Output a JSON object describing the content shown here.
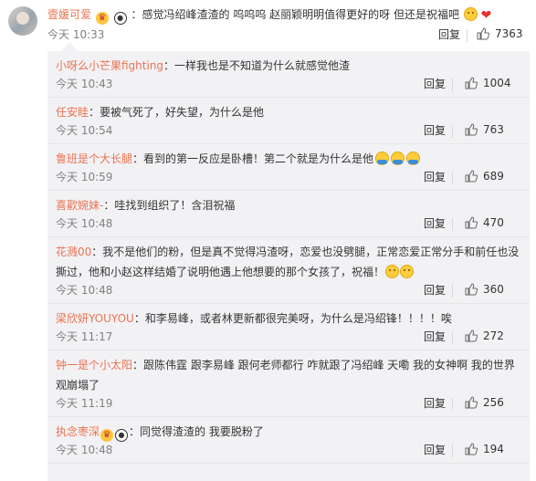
{
  "top_comment": {
    "username": "壹媛可爱",
    "badges": [
      "gold-badge",
      "panda-badge"
    ],
    "text": "：感觉冯绍峰渣渣的 呜呜呜 赵丽颖明明值得更好的呀 但还是祝福吧",
    "emojis": [
      "sad-face-emoji",
      "heart-icon"
    ],
    "time": "今天 10:33",
    "reply_label": "回复",
    "likes": "7363"
  },
  "sub_comments": [
    {
      "username": "小呀么小芒果fighting",
      "badges": [],
      "text": "：一样我也是不知道为什么就感觉他渣",
      "time": "今天 10:43",
      "reply_label": "回复",
      "likes": "1004"
    },
    {
      "username": "任安眭",
      "badges": [],
      "text": "：要被气死了，好失望，为什么是他",
      "time": "今天 10:54",
      "reply_label": "回复",
      "likes": "763"
    },
    {
      "username": "鲁班是个大长腿",
      "badges": [],
      "text": "：看到的第一反应是卧槽！第二个就是为什么是他",
      "emojis": [
        "hug-emoji",
        "hug-emoji",
        "hug-emoji"
      ],
      "time": "今天 10:59",
      "reply_label": "回复",
      "likes": "689"
    },
    {
      "username": "喜歡婉妹-",
      "badges": [],
      "text": "：哇找到组织了！含泪祝福",
      "time": "今天 10:48",
      "reply_label": "回复",
      "likes": "470"
    },
    {
      "username": "花溅00",
      "badges": [],
      "text": "：我不是他们的粉，但是真不觉得冯渣呀，恋爱也没劈腿，正常恋爱正常分手和前任也没撕过，他和小赵这样结婚了说明他遇上他想要的那个女孩了，祝福！",
      "emojis": [
        "smile-emoji",
        "smile-emoji"
      ],
      "time": "今天 10:48",
      "reply_label": "回复",
      "likes": "360"
    },
    {
      "username": "梁欣妍YOUYOU",
      "badges": [],
      "text": "：和李易峰，或者林更新都很完美呀，为什么是冯绍锋！！！！唉",
      "time": "今天 11:17",
      "reply_label": "回复",
      "likes": "272"
    },
    {
      "username": "钟一是个小太阳",
      "badges": [],
      "text": "：跟陈伟霆 跟李易峰 跟何老师都行 咋就跟了冯绍峰 天嘞 我的女神啊 我的世界观崩塌了",
      "time": "今天 11:19",
      "reply_label": "回复",
      "likes": "256"
    },
    {
      "username": "执念枣深",
      "badges": [
        "gold-badge",
        "panda-badge"
      ],
      "text": "：同觉得渣渣的  我要脱粉了",
      "time": "今天 10:48",
      "reply_label": "回复",
      "likes": "194"
    }
  ]
}
